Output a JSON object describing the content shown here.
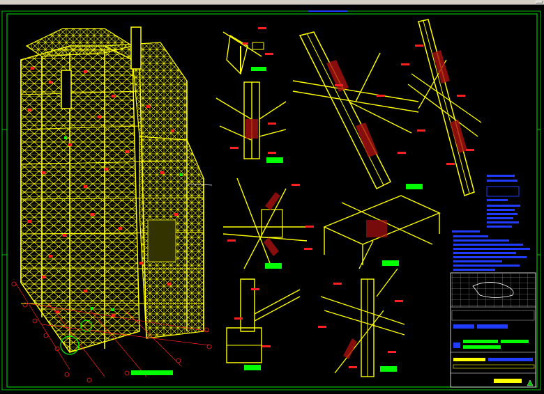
{
  "window": {
    "title": "",
    "viewport": "model-space"
  },
  "drawing": {
    "frame_color": "#00c000",
    "structure_color": "#ffff00",
    "callout_color": "#ff2020",
    "label_color": "#00ff00",
    "note_color": "#1f3cff",
    "background": "#000000"
  },
  "views": [
    {
      "id": "main-tower",
      "kind": "isometric-frame"
    },
    {
      "id": "detail-1",
      "kind": "joint-detail"
    },
    {
      "id": "detail-2",
      "kind": "joint-detail"
    },
    {
      "id": "detail-3",
      "kind": "joint-detail"
    },
    {
      "id": "detail-4",
      "kind": "joint-detail"
    },
    {
      "id": "detail-5",
      "kind": "joint-detail"
    },
    {
      "id": "detail-6",
      "kind": "joint-detail"
    },
    {
      "id": "detail-7",
      "kind": "joint-detail"
    },
    {
      "id": "detail-8",
      "kind": "joint-detail"
    },
    {
      "id": "detail-9",
      "kind": "joint-detail"
    }
  ],
  "title_block": {
    "present": true,
    "marker_icon": "triangle-icon"
  }
}
